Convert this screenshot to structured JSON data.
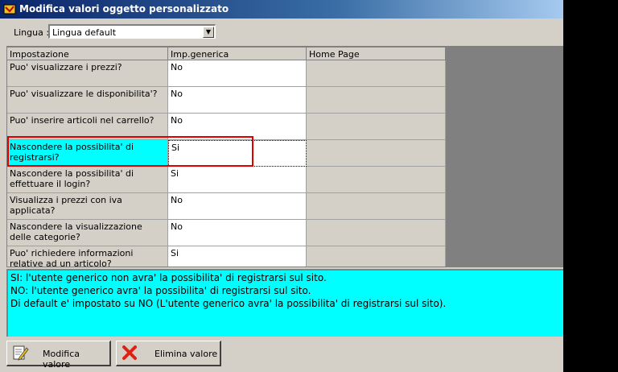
{
  "window": {
    "title": "Modifica valori oggetto personalizzato"
  },
  "language": {
    "label": "Lingua :",
    "selected": "Lingua default"
  },
  "grid": {
    "headers": [
      "Impostazione",
      "Imp.generica",
      "Home Page"
    ],
    "rows": [
      {
        "setting": "Puo' visualizzare i prezzi?",
        "value": "No",
        "home": ""
      },
      {
        "setting": "Puo' visualizzare le disponibilita'?",
        "value": "No",
        "home": ""
      },
      {
        "setting": "Puo' inserire articoli nel carrello?",
        "value": "No",
        "home": ""
      },
      {
        "setting": "Nascondere la possibilita' di registrarsi?",
        "value": "Si",
        "home": ""
      },
      {
        "setting": "Nascondere la possibilita' di effettuare il login?",
        "value": "Si",
        "home": ""
      },
      {
        "setting": "Visualizza i prezzi con iva applicata?",
        "value": "No",
        "home": ""
      },
      {
        "setting": "Nascondere la visualizzazione delle categorie?",
        "value": "No",
        "home": ""
      },
      {
        "setting": "Puo' richiedere informazioni relative ad un articolo?",
        "value": "Si",
        "home": ""
      }
    ]
  },
  "description": [
    "SI: l'utente generico non avra' la possibilita' di registrarsi sul sito.",
    "NO: l'utente  generico avra' la possibilita' di registrarsi sul sito.",
    "Di default e' impostato su NO (L'utente  generico avra' la possibilita' di registrarsi sul sito)."
  ],
  "buttons": {
    "modify": "Modifica valore",
    "delete": "Elimina valore"
  },
  "colors": {
    "selection": "#00ffff",
    "highlight": "#e00000"
  }
}
